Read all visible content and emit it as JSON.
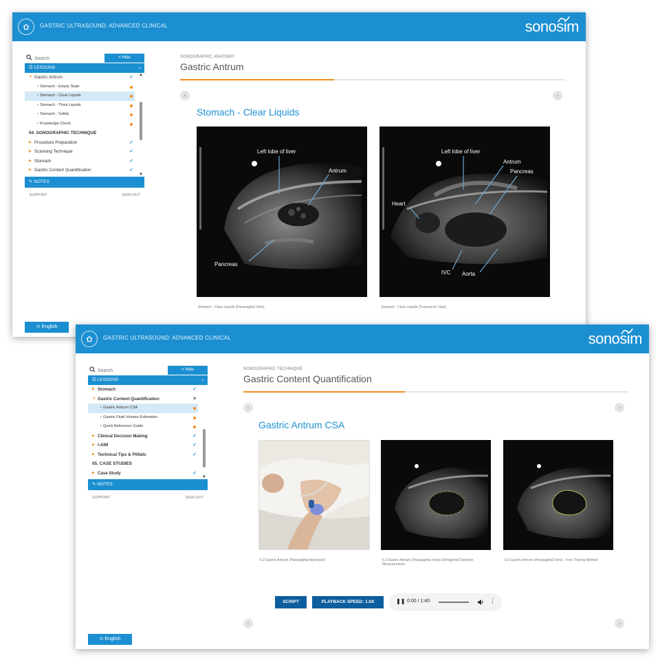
{
  "window1": {
    "app_title": "GASTRIC ULTRASOUND: ADVANCED CLINICAL",
    "logo": "sonosim",
    "search_placeholder": "Search",
    "hide_label": "< Hide",
    "lessons_label": "LESSONS",
    "tree": [
      {
        "label": "Gastric Antrum",
        "level": 1,
        "status": "check",
        "expanded": true
      },
      {
        "label": "Stomach - Empty State",
        "level": 2,
        "status": "dot"
      },
      {
        "label": "Stomach - Clear Liquids",
        "level": 2,
        "status": "dot",
        "selected": true
      },
      {
        "label": "Stomach - Thick Liquids",
        "level": 2,
        "status": "dot"
      },
      {
        "label": "Stomach - Solids",
        "level": 2,
        "status": "dot"
      },
      {
        "label": "Knowledge Check",
        "level": 2,
        "status": "dot"
      },
      {
        "label": "04. SONOGRAPHIC TECHNIQUE",
        "level": 0
      },
      {
        "label": "Procedure Preparation",
        "level": 1,
        "status": "check"
      },
      {
        "label": "Scanning Technique",
        "level": 1,
        "status": "check"
      },
      {
        "label": "Stomach",
        "level": 1,
        "status": "check"
      },
      {
        "label": "Gastric Content Quantification",
        "level": 1,
        "status": "check"
      }
    ],
    "notes_label": "NOTES",
    "support_label": "SUPPORT",
    "signout_label": "SIGN OUT",
    "language_label": "English",
    "breadcrumb": "SONOGRAPHIC ANATOMY",
    "page_title": "Gastric Antrum",
    "progress": 0.4,
    "section_title": "Stomach - Clear Liquids",
    "images": [
      {
        "labels": [
          "Left lobe of liver",
          "Antrum",
          "Pancreas"
        ],
        "caption": "Stomach - Clear Liquids (Parasagittal View)"
      },
      {
        "labels": [
          "Left lobe of liver",
          "Antrum",
          "Pancreas",
          "Heart",
          "IVC",
          "Aorta"
        ],
        "caption": "Stomach - Clear Liquids (Transverse View)"
      }
    ]
  },
  "window2": {
    "app_title": "GASTRIC ULTRASOUND: ADVANCED CLINICAL",
    "logo": "sonosim",
    "search_placeholder": "Search",
    "hide_label": "< Hide",
    "lessons_label": "LESSONS",
    "tree": [
      {
        "label": "Stomach",
        "level": 1,
        "status": "check",
        "bold": true
      },
      {
        "label": "Gastric Content Quantification",
        "level": 1,
        "status": "close",
        "expanded": true,
        "bold": true
      },
      {
        "label": "Gastric Antrum CSA",
        "level": 2,
        "status": "dot",
        "selected": true
      },
      {
        "label": "Gastric Fluid Volume Estimation",
        "level": 2,
        "status": "dot"
      },
      {
        "label": "Quick Reference Guide",
        "level": 2,
        "status": "dot"
      },
      {
        "label": "Clinical Decision Making",
        "level": 1,
        "status": "check",
        "bold": true
      },
      {
        "label": "I-AIM",
        "level": 1,
        "status": "check",
        "bold": true
      },
      {
        "label": "Technical Tips & Pitfalls",
        "level": 1,
        "status": "check",
        "bold": true
      },
      {
        "label": "05. CASE STUDIES",
        "level": 0
      },
      {
        "label": "Case Study",
        "level": 1,
        "status": "check",
        "bold": true
      }
    ],
    "notes_label": "NOTES",
    "support_label": "SUPPORT",
    "signout_label": "SIGN OUT",
    "language_label": "English",
    "breadcrumb": "SONOGRAPHIC TECHNIQUE",
    "page_title": "Gastric Content Quantification",
    "progress": 0.42,
    "section_title": "Gastric Antrum CSA",
    "captions": [
      "6.3 Gastric Antrum (Parasagittal Approach)",
      "6.3 Gastric Antrum (Parasagittal View) Orthogonal Diameter Measurements",
      "6.3 Gastric Antrum (Parasagittal View) - Free Tracing Method"
    ],
    "script_label": "SCRIPT",
    "playback_label": "PLAYBACK SPEED: 1.0X",
    "player_time": "0:00 / 1:40"
  }
}
